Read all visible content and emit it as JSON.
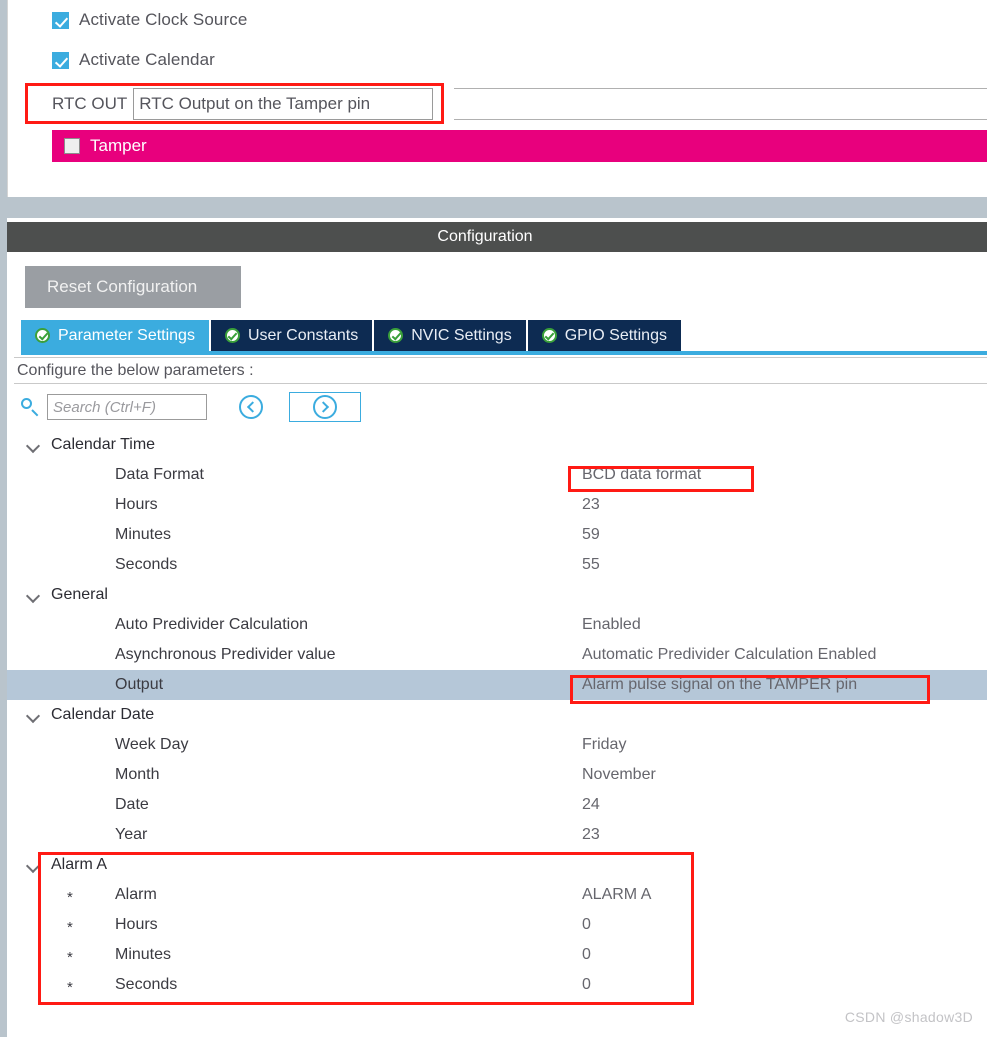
{
  "top_panel": {
    "checkboxes": [
      {
        "label": "Activate Clock Source",
        "checked": true
      },
      {
        "label": "Activate Calendar",
        "checked": true
      }
    ],
    "rtc_out": {
      "label": "RTC OUT",
      "value": "RTC Output on the Tamper pin"
    },
    "tamper": {
      "label": "Tamper",
      "checked": false,
      "bar_color": "#e8007d"
    }
  },
  "config": {
    "header_title": "Configuration",
    "reset_button": "Reset Configuration",
    "tabs": [
      {
        "label": "Parameter Settings",
        "icon": "check-circle-icon",
        "active": true
      },
      {
        "label": "User Constants",
        "icon": "check-circle-icon",
        "active": false
      },
      {
        "label": "NVIC Settings",
        "icon": "check-circle-icon",
        "active": false
      },
      {
        "label": "GPIO Settings",
        "icon": "check-circle-icon",
        "active": false
      }
    ],
    "instruction": "Configure the below parameters :",
    "search": {
      "placeholder": "Search (Ctrl+F)",
      "value": "",
      "icon": "search-icon"
    },
    "nav_prev_icon": "chevron-left-circle-icon",
    "nav_next_icon": "chevron-right-circle-icon"
  },
  "tree": {
    "groups": [
      {
        "name": "Calendar Time",
        "expanded": true,
        "rows": [
          {
            "star": "",
            "name": "Data Format",
            "value": "BCD data format",
            "selected": false
          },
          {
            "star": "",
            "name": "Hours",
            "value": "23",
            "selected": false
          },
          {
            "star": "",
            "name": "Minutes",
            "value": "59",
            "selected": false
          },
          {
            "star": "",
            "name": "Seconds",
            "value": "55",
            "selected": false
          }
        ]
      },
      {
        "name": "General",
        "expanded": true,
        "rows": [
          {
            "star": "",
            "name": "Auto Predivider Calculation",
            "value": "Enabled",
            "selected": false
          },
          {
            "star": "",
            "name": "Asynchronous Predivider value",
            "value": "Automatic Predivider Calculation Enabled",
            "selected": false
          },
          {
            "star": "",
            "name": "Output",
            "value": "Alarm pulse signal on the TAMPER pin",
            "selected": true
          }
        ]
      },
      {
        "name": "Calendar Date",
        "expanded": true,
        "rows": [
          {
            "star": "",
            "name": "Week Day",
            "value": "Friday",
            "selected": false
          },
          {
            "star": "",
            "name": "Month",
            "value": "November",
            "selected": false
          },
          {
            "star": "",
            "name": "Date",
            "value": "24",
            "selected": false
          },
          {
            "star": "",
            "name": "Year",
            "value": "23",
            "selected": false
          }
        ]
      },
      {
        "name": "Alarm A",
        "expanded": true,
        "rows": [
          {
            "star": "*",
            "name": "Alarm",
            "value": "ALARM A",
            "selected": false
          },
          {
            "star": "*",
            "name": "Hours",
            "value": "0",
            "selected": false
          },
          {
            "star": "*",
            "name": "Minutes",
            "value": "0",
            "selected": false
          },
          {
            "star": "*",
            "name": "Seconds",
            "value": "0",
            "selected": false
          }
        ]
      }
    ]
  },
  "annotations": {
    "color": "#ff1a14",
    "boxes": [
      "rtc-out-row",
      "data-format-value",
      "output-value",
      "alarm-a-group"
    ]
  },
  "watermark": "CSDN @shadow3D"
}
